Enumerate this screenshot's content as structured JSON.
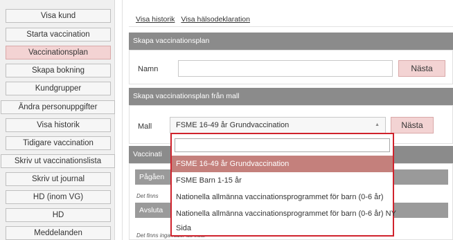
{
  "sidebar": {
    "items": [
      {
        "label": "Visa kund"
      },
      {
        "label": "Starta vaccination"
      },
      {
        "label": "Vaccinationsplan",
        "active": true
      },
      {
        "label": "Skapa bokning"
      },
      {
        "label": "Kundgrupper"
      },
      {
        "label": "Ändra personuppgifter"
      },
      {
        "label": "Visa historik"
      },
      {
        "label": "Tidigare vaccination"
      },
      {
        "label": "Skriv ut vaccinationslista"
      },
      {
        "label": "Skriv ut journal"
      },
      {
        "label": "HD (inom VG)"
      },
      {
        "label": "HD"
      },
      {
        "label": "Meddelanden"
      }
    ]
  },
  "links": {
    "history": "Visa historik",
    "health": "Visa hälsodeklaration"
  },
  "create_plan": {
    "header": "Skapa vaccinationsplan",
    "name_label": "Namn",
    "name_value": "",
    "next_label": "Nästa"
  },
  "from_template": {
    "header": "Skapa vaccinationsplan från mall",
    "template_label": "Mall",
    "selected": "FSME 16-49 år Grundvaccination",
    "next_label": "Nästa"
  },
  "lower": {
    "header_partial": "Vaccinati",
    "ongoing_partial": "Pågåen",
    "note_partial": "Det finns",
    "finished_partial": "Avsluta",
    "bottom_note": "Det finns inga rader att visa."
  },
  "dropdown": {
    "search_value": "",
    "options": [
      "FSME 16-49 år Grundvaccination",
      "FSME Barn 1-15 år",
      "Nationella allmänna vaccinationsprogrammet för barn (0-6 år)",
      "Nationella allmänna vaccinationsprogrammet för barn (0-6 år) NY",
      "Sida"
    ],
    "selected_index": 0
  },
  "colors": {
    "accent_pink": "#f3d3d3",
    "panel_header": "#8b8b8b",
    "dropdown_border": "#d0222c",
    "selected_option": "#c4807c"
  }
}
